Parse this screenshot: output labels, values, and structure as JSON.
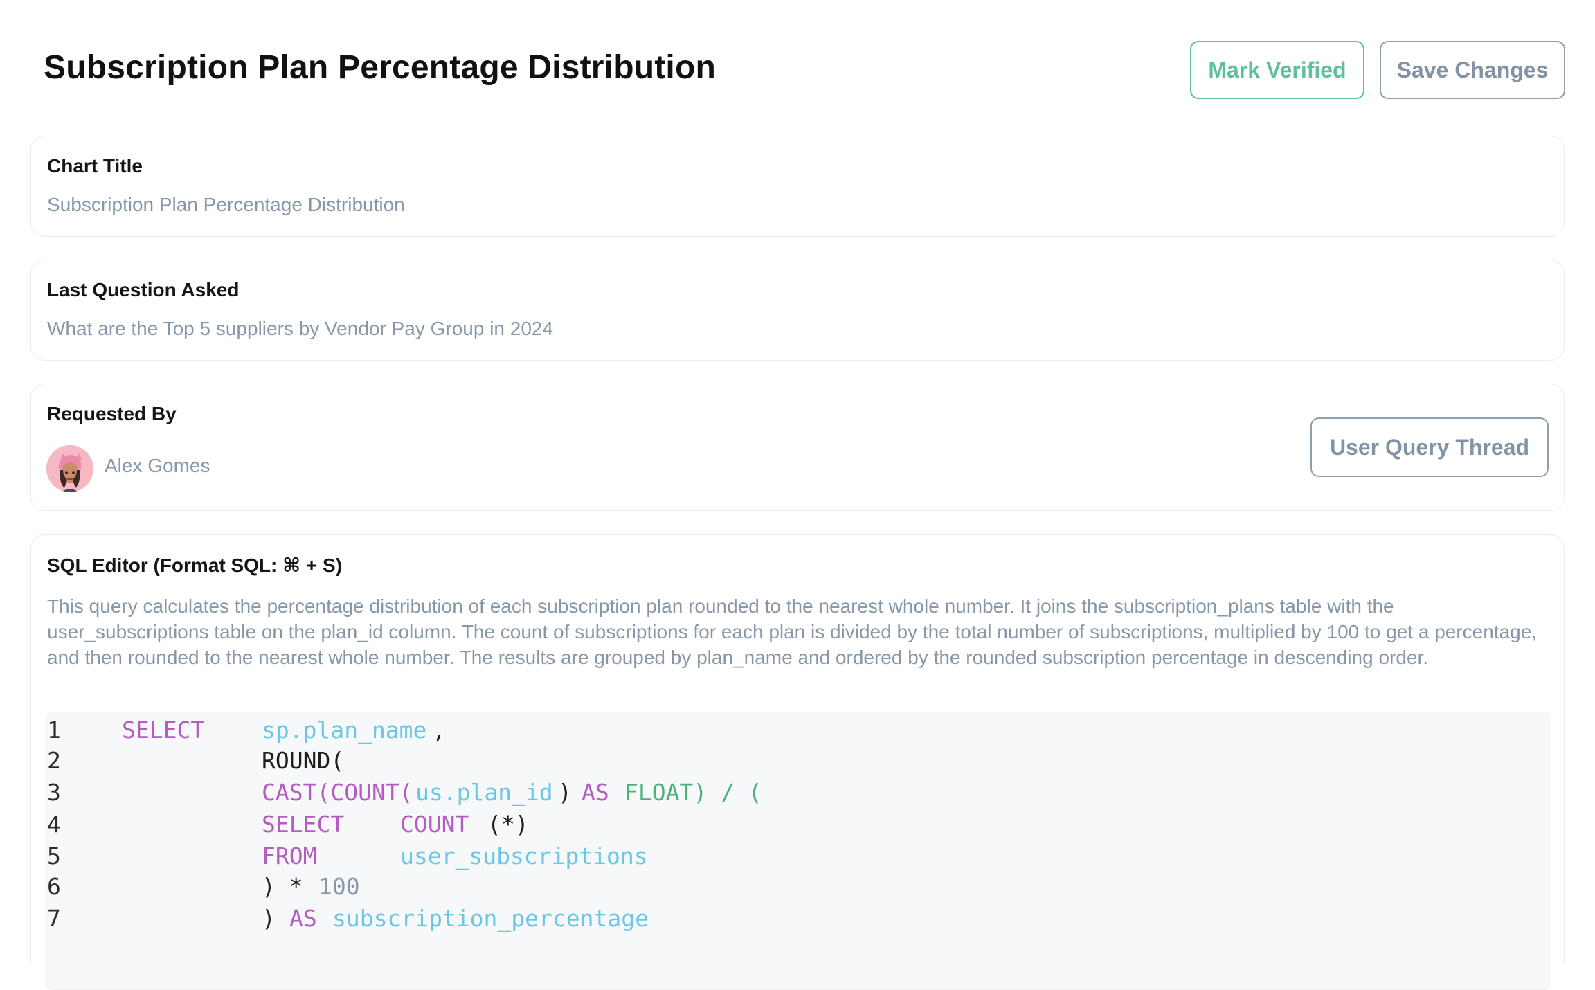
{
  "header": {
    "title": "Subscription Plan Percentage Distribution",
    "mark_verified_label": "Mark Verified",
    "save_changes_label": "Save Changes"
  },
  "chart_title_card": {
    "label": "Chart Title",
    "value": "Subscription Plan Percentage Distribution"
  },
  "last_question_card": {
    "label": "Last Question Asked",
    "value": "What are the Top 5 suppliers by Vendor Pay Group in 2024"
  },
  "requested_by_card": {
    "label": "Requested By",
    "user_name": "Alex Gomes",
    "thread_button_label": "User Query Thread"
  },
  "sql_editor": {
    "label": "SQL Editor (Format SQL: ⌘ + S)",
    "description": "This query calculates the percentage distribution of each subscription plan rounded to the nearest whole number. It joins the subscription_plans table with the user_subscriptions table on the plan_id column. The count of subscriptions for each plan is divided by the total number of subscriptions, multiplied by 100 to get a percentage, and then rounded to the nearest whole number. The results are grouped by plan_name and ordered by the rounded subscription percentage in descending order.",
    "lines": [
      {
        "n": "1",
        "t": [
          {
            "s": "SELECT",
            "c": "kw"
          },
          {
            "s": "sp.plan_name",
            "c": "id"
          },
          {
            "s": ",",
            "c": "pl"
          }
        ]
      },
      {
        "n": "2",
        "t": [
          {
            "s": "ROUND(",
            "c": "pl"
          }
        ]
      },
      {
        "n": "3",
        "t": [
          {
            "s": "CAST(COUNT(",
            "c": "kw"
          },
          {
            "s": "us.plan_id",
            "c": "id"
          },
          {
            "s": ")",
            "c": "pl"
          },
          {
            "s": "AS",
            "c": "kw"
          },
          {
            "s": "FLOAT) / (",
            "c": "fn"
          }
        ]
      },
      {
        "n": "4",
        "t": [
          {
            "s": "SELECT",
            "c": "kw"
          },
          {
            "s": "COUNT",
            "c": "kw"
          },
          {
            "s": "(*)",
            "c": "pl"
          }
        ]
      },
      {
        "n": "5",
        "t": [
          {
            "s": "FROM",
            "c": "kw"
          },
          {
            "s": "user_subscriptions",
            "c": "id"
          }
        ]
      },
      {
        "n": "6",
        "t": [
          {
            "s": ") *",
            "c": "pl"
          },
          {
            "s": "100",
            "c": "num"
          }
        ]
      },
      {
        "n": "7",
        "t": [
          {
            "s": ")",
            "c": "pl"
          },
          {
            "s": "AS",
            "c": "kw"
          },
          {
            "s": "subscription_percentage",
            "c": "id"
          }
        ]
      }
    ]
  },
  "colors": {
    "verify_accent": "#5fbf9a",
    "secondary_text": "#8797a8",
    "keyword": "#b45cc2",
    "identifier": "#69c6e4",
    "function": "#4bb07a"
  }
}
